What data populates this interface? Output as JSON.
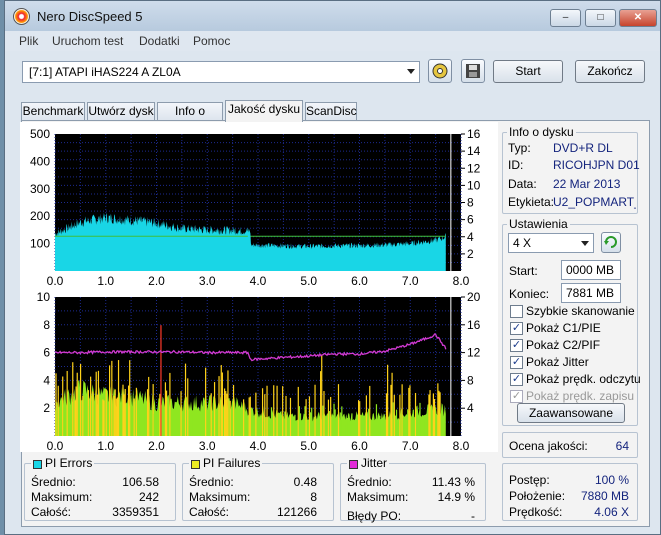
{
  "window": {
    "title": "Nero DiscSpeed 5",
    "min_label": "–",
    "max_label": "□",
    "close_label": "✕"
  },
  "menu": [
    "Plik",
    "Uruchom test",
    "Dodatki",
    "Pomoc"
  ],
  "toolbar": {
    "drive": "[7:1]   ATAPI iHAS224   A ZL0A",
    "start_label": "Start",
    "stop_label": "Zakończ"
  },
  "tabs": [
    "Benchmark",
    "Utwórz dysk",
    "Info o dysku",
    "Jakość dysku",
    "ScanDisc"
  ],
  "active_tab": "Jakość dysku",
  "disc_info": {
    "title": "Info o dysku",
    "rows": [
      {
        "label": "Typ:",
        "value": "DVD+R DL"
      },
      {
        "label": "ID:",
        "value": "RICOHJPN D01"
      },
      {
        "label": "Data:",
        "value": "22 Mar 2013"
      },
      {
        "label": "Etykieta:",
        "value": "U2_POPMART_I"
      }
    ]
  },
  "settings": {
    "title": "Ustawienia",
    "speed": "4 X",
    "start_label": "Start:",
    "start_value": "0000 MB",
    "end_label": "Koniec:",
    "end_value": "7881 MB",
    "checks": [
      {
        "label": "Szybkie skanowanie",
        "checked": "",
        "disabled": false
      },
      {
        "label": "Pokaż C1/PIE",
        "checked": "✓",
        "disabled": false
      },
      {
        "label": "Pokaż C2/PIF",
        "checked": "✓",
        "disabled": false
      },
      {
        "label": "Pokaż Jitter",
        "checked": "✓",
        "disabled": false
      },
      {
        "label": "Pokaż prędk. odczytu",
        "checked": "✓",
        "disabled": false
      },
      {
        "label": "Pokaż prędk. zapisu",
        "checked": "✓",
        "disabled": true
      }
    ],
    "advanced_label": "Zaawansowane"
  },
  "quality": {
    "label": "Ocena jakości:",
    "value": "64"
  },
  "progress": {
    "rows": [
      {
        "label": "Postęp:",
        "value": "100 %"
      },
      {
        "label": "Położenie:",
        "value": "7880 MB"
      },
      {
        "label": "Prędkość:",
        "value": "4.06 X"
      }
    ]
  },
  "stats": {
    "pi_errors": {
      "title": "PI Errors",
      "color": "#19d6e6",
      "avg_label": "Średnio:",
      "avg": "106.58",
      "max_label": "Maksimum:",
      "max": "242",
      "total_label": "Całość:",
      "total": "3359351"
    },
    "pi_failures": {
      "title": "PI Failures",
      "color": "#ecec22",
      "avg_label": "Średnio:",
      "avg": "0.48",
      "max_label": "Maksimum:",
      "max": "8",
      "total_label": "Całość:",
      "total": "121266"
    },
    "jitter": {
      "title": "Jitter",
      "color": "#e22ad8",
      "avg_label": "Średnio:",
      "avg": "11.43 %",
      "max_label": "Maksimum:",
      "max": "14.9 %",
      "po_label": "Błędy PO:",
      "po": "-"
    }
  },
  "colors": {
    "pie_fill": "#19d6e6",
    "pif_low": "#8fe620",
    "pif_high": "#ffd21a",
    "pif_red": "#ff3a2a",
    "jitter": "#d23ad2",
    "speed": "#3fc03a",
    "plot_bg": "#000",
    "grid": "#1c2a8f"
  },
  "chart_data": [
    {
      "type": "area",
      "title": "PI Errors",
      "x_ticks": [
        "0.0",
        "1.0",
        "2.0",
        "3.0",
        "4.0",
        "5.0",
        "6.0",
        "7.0",
        "8.0"
      ],
      "y_ticks_left": [
        "100",
        "200",
        "300",
        "400",
        "500"
      ],
      "y_ticks_right": [
        "2",
        "4",
        "6",
        "8",
        "10",
        "12",
        "14",
        "16"
      ],
      "xlim": [
        0,
        8
      ],
      "ylim_left": [
        0,
        500
      ],
      "ylim_right": [
        0,
        16
      ],
      "series": [
        {
          "name": "PI Errors",
          "x": [
            0,
            0.5,
            1.0,
            1.5,
            2.0,
            2.5,
            3.0,
            3.5,
            3.85,
            3.86,
            4.5,
            5.0,
            5.5,
            6.0,
            6.5,
            7.0,
            7.5,
            7.7
          ],
          "values": [
            135,
            178,
            195,
            185,
            175,
            155,
            150,
            148,
            145,
            95,
            92,
            90,
            92,
            93,
            95,
            100,
            112,
            125
          ]
        },
        {
          "name": "Read speed (X)",
          "x": [
            0,
            3.8,
            3.85,
            7.7
          ],
          "values": [
            4.06,
            4.06,
            4.06,
            4.06
          ]
        }
      ],
      "grid": true
    },
    {
      "type": "bar",
      "title": "PI Failures / Jitter",
      "x_ticks": [
        "0.0",
        "1.0",
        "2.0",
        "3.0",
        "4.0",
        "5.0",
        "6.0",
        "7.0",
        "8.0"
      ],
      "y_ticks_left": [
        "2",
        "4",
        "6",
        "8",
        "10"
      ],
      "y_ticks_right": [
        "4",
        "8",
        "12",
        "16",
        "20"
      ],
      "xlim": [
        0,
        8
      ],
      "ylim_left": [
        0,
        10
      ],
      "ylim_right": [
        0,
        20
      ],
      "series": [
        {
          "name": "PI Failures",
          "x": [
            0,
            0.5,
            1.0,
            1.5,
            2.0,
            2.5,
            3.0,
            3.5,
            3.85,
            4.5,
            5.0,
            5.5,
            6.0,
            6.5,
            7.0,
            7.5,
            7.7
          ],
          "values": [
            2.5,
            3.5,
            3.0,
            3.0,
            2.5,
            2.5,
            2.5,
            2.5,
            2.0,
            1.5,
            1.5,
            1.5,
            1.5,
            1.5,
            1.8,
            2.0,
            2.0
          ]
        },
        {
          "name": "Jitter",
          "x": [
            0,
            0.5,
            1.0,
            1.5,
            2.0,
            2.5,
            3.0,
            3.5,
            3.8,
            3.85,
            4.5,
            5.0,
            5.5,
            6.0,
            6.5,
            7.0,
            7.3,
            7.5,
            7.7
          ],
          "values": [
            12.0,
            12.0,
            12.1,
            12.1,
            12.1,
            12.1,
            12.0,
            12.0,
            12.0,
            11.0,
            11.3,
            11.5,
            11.8,
            11.8,
            12.2,
            13.2,
            14.0,
            14.6,
            12.6
          ]
        }
      ],
      "grid": true
    }
  ]
}
